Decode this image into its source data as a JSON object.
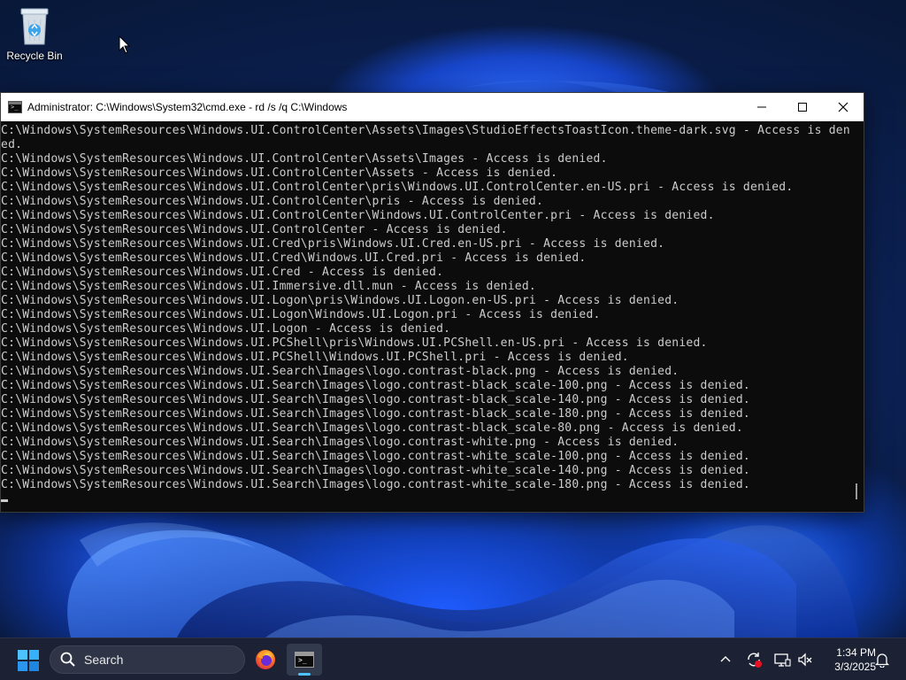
{
  "desktop": {
    "icons": [
      {
        "label": "Recycle Bin",
        "icon": "recycle-bin-icon"
      }
    ]
  },
  "console": {
    "title": "Administrator: C:\\Windows\\System32\\cmd.exe - rd  /s /q C:\\Windows",
    "icon": "cmd-icon",
    "controls": {
      "minimize": "minimize-icon",
      "maximize": "maximize-icon",
      "close": "close-icon"
    },
    "lines": [
      "C:\\Windows\\SystemResources\\Windows.UI.ControlCenter\\Assets\\Images\\StudioEffectsToastIcon.theme-dark.svg - Access is deni",
      "ed.",
      "C:\\Windows\\SystemResources\\Windows.UI.ControlCenter\\Assets\\Images - Access is denied.",
      "C:\\Windows\\SystemResources\\Windows.UI.ControlCenter\\Assets - Access is denied.",
      "C:\\Windows\\SystemResources\\Windows.UI.ControlCenter\\pris\\Windows.UI.ControlCenter.en-US.pri - Access is denied.",
      "C:\\Windows\\SystemResources\\Windows.UI.ControlCenter\\pris - Access is denied.",
      "C:\\Windows\\SystemResources\\Windows.UI.ControlCenter\\Windows.UI.ControlCenter.pri - Access is denied.",
      "C:\\Windows\\SystemResources\\Windows.UI.ControlCenter - Access is denied.",
      "C:\\Windows\\SystemResources\\Windows.UI.Cred\\pris\\Windows.UI.Cred.en-US.pri - Access is denied.",
      "C:\\Windows\\SystemResources\\Windows.UI.Cred\\Windows.UI.Cred.pri - Access is denied.",
      "C:\\Windows\\SystemResources\\Windows.UI.Cred - Access is denied.",
      "C:\\Windows\\SystemResources\\Windows.UI.Immersive.dll.mun - Access is denied.",
      "C:\\Windows\\SystemResources\\Windows.UI.Logon\\pris\\Windows.UI.Logon.en-US.pri - Access is denied.",
      "C:\\Windows\\SystemResources\\Windows.UI.Logon\\Windows.UI.Logon.pri - Access is denied.",
      "C:\\Windows\\SystemResources\\Windows.UI.Logon - Access is denied.",
      "C:\\Windows\\SystemResources\\Windows.UI.PCShell\\pris\\Windows.UI.PCShell.en-US.pri - Access is denied.",
      "C:\\Windows\\SystemResources\\Windows.UI.PCShell\\Windows.UI.PCShell.pri - Access is denied.",
      "C:\\Windows\\SystemResources\\Windows.UI.Search\\Images\\logo.contrast-black.png - Access is denied.",
      "C:\\Windows\\SystemResources\\Windows.UI.Search\\Images\\logo.contrast-black_scale-100.png - Access is denied.",
      "C:\\Windows\\SystemResources\\Windows.UI.Search\\Images\\logo.contrast-black_scale-140.png - Access is denied.",
      "C:\\Windows\\SystemResources\\Windows.UI.Search\\Images\\logo.contrast-black_scale-180.png - Access is denied.",
      "C:\\Windows\\SystemResources\\Windows.UI.Search\\Images\\logo.contrast-black_scale-80.png - Access is denied.",
      "C:\\Windows\\SystemResources\\Windows.UI.Search\\Images\\logo.contrast-white.png - Access is denied.",
      "C:\\Windows\\SystemResources\\Windows.UI.Search\\Images\\logo.contrast-white_scale-100.png - Access is denied.",
      "C:\\Windows\\SystemResources\\Windows.UI.Search\\Images\\logo.contrast-white_scale-140.png - Access is denied.",
      "C:\\Windows\\SystemResources\\Windows.UI.Search\\Images\\logo.contrast-white_scale-180.png - Access is denied."
    ],
    "colors": {
      "background": "#0c0c0c",
      "text": "#cccccc"
    }
  },
  "taskbar": {
    "search_label": "Search",
    "apps": [
      {
        "name": "Firefox",
        "icon": "firefox-icon"
      },
      {
        "name": "Command Prompt",
        "icon": "cmd-icon",
        "active": true
      }
    ],
    "tray": {
      "icons": [
        "chevron-up-icon",
        "sync-alert-icon",
        "network-icon",
        "volume-muted-icon",
        "notification-bell-icon"
      ]
    },
    "clock": {
      "time": "1:34 PM",
      "date": "3/3/2025"
    },
    "colors": {
      "background": "#1c2233",
      "accent": "#4cc2ff"
    }
  }
}
